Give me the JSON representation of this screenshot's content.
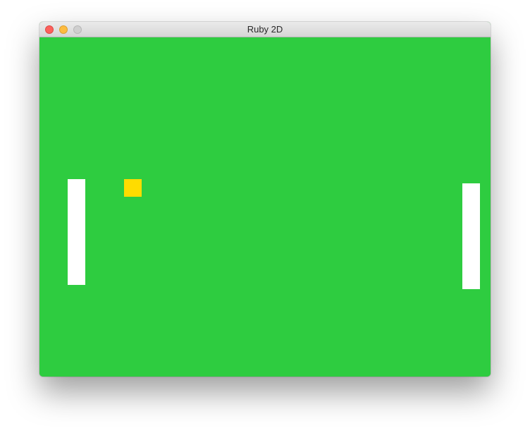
{
  "window": {
    "title": "Ruby 2D"
  },
  "game": {
    "background_color": "#2ecc40",
    "left_paddle": {
      "color": "#ffffff"
    },
    "right_paddle": {
      "color": "#ffffff"
    },
    "ball": {
      "color": "#ffdc00"
    }
  }
}
